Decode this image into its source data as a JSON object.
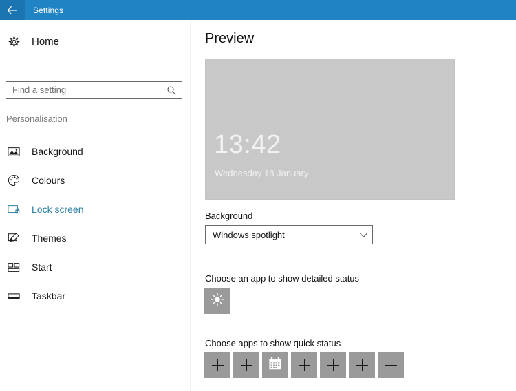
{
  "titlebar": {
    "back_icon": "back-arrow-icon",
    "title": "Settings"
  },
  "sidebar": {
    "home": {
      "icon": "gear-icon",
      "label": "Home"
    },
    "search": {
      "placeholder": "Find a setting",
      "value": "",
      "icon": "search-icon"
    },
    "section_header": "Personalisation",
    "items": [
      {
        "label": "Background",
        "icon": "image-icon",
        "selected": false
      },
      {
        "label": "Colours",
        "icon": "palette-icon",
        "selected": false
      },
      {
        "label": "Lock screen",
        "icon": "lockscreen-icon",
        "selected": true
      },
      {
        "label": "Themes",
        "icon": "brush-icon",
        "selected": false
      },
      {
        "label": "Start",
        "icon": "tiles-icon",
        "selected": false
      },
      {
        "label": "Taskbar",
        "icon": "taskbar-icon",
        "selected": false
      }
    ]
  },
  "pane": {
    "title": "Preview",
    "preview": {
      "clock": "13:42",
      "date": "Wednesday 18 January",
      "background_colour": "#c8c8c8"
    },
    "background": {
      "label": "Background",
      "selected_option": "Windows spotlight",
      "chevron_icon": "chevron-down-icon"
    },
    "detailed_status": {
      "label": "Choose an app to show detailed status",
      "tiles": [
        {
          "icon": "weather-sun-icon"
        }
      ]
    },
    "quick_status": {
      "label": "Choose apps to show quick status",
      "tiles": [
        {
          "icon": "plus-icon"
        },
        {
          "icon": "plus-icon"
        },
        {
          "icon": "calendar-icon"
        },
        {
          "icon": "plus-icon"
        },
        {
          "icon": "plus-icon"
        },
        {
          "icon": "plus-icon"
        },
        {
          "icon": "plus-icon"
        }
      ]
    }
  },
  "colours": {
    "titlebar": "#2083c4",
    "titlebar_back": "#1b75b0",
    "accent_selected": "#2b7fa0",
    "tile": "#9a9a9a",
    "preview": "#c8c8c8"
  }
}
